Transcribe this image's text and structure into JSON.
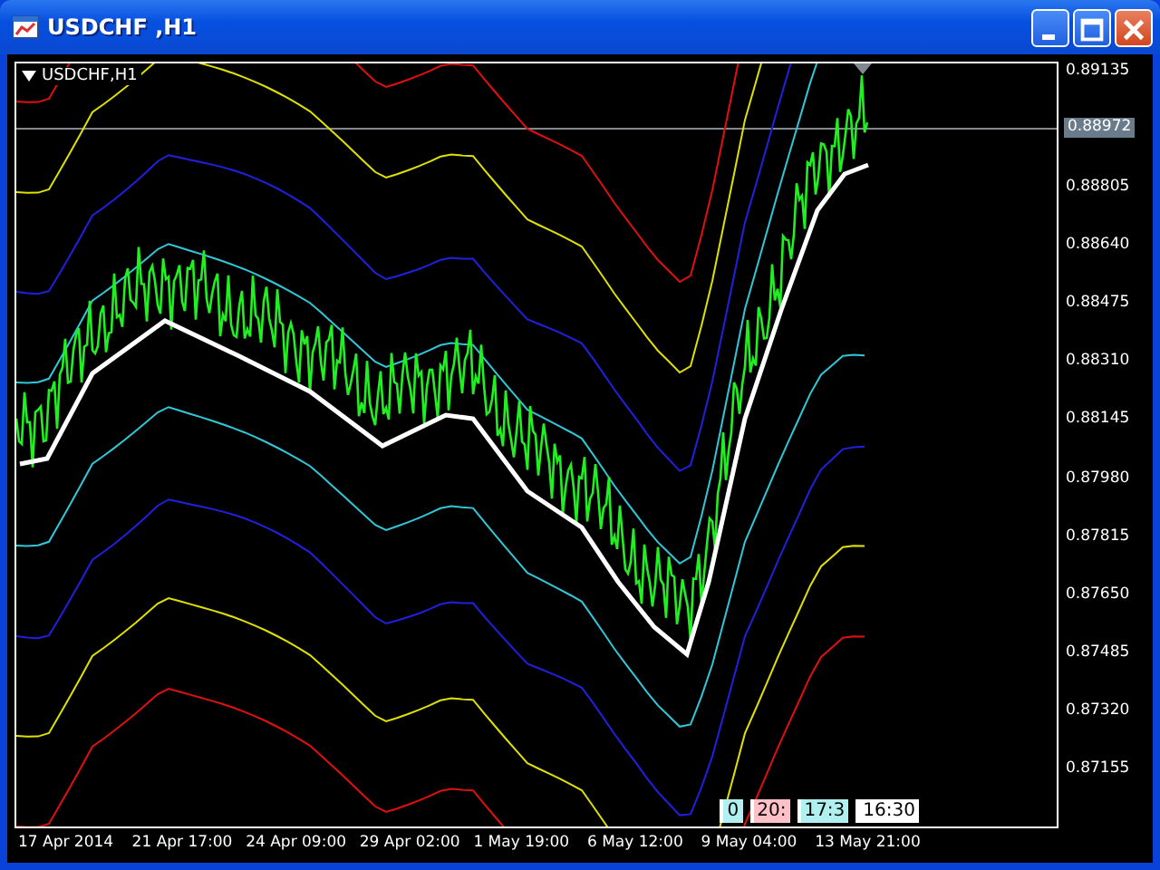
{
  "window": {
    "title": "USDCHF ,H1"
  },
  "chart": {
    "symbol_label": "USDCHF,H1",
    "price_tag": "0.88972",
    "y_axis": [
      "0.89135",
      "0.88805",
      "0.88640",
      "0.88475",
      "0.88310",
      "0.88145",
      "0.87980",
      "0.87815",
      "0.87650",
      "0.87485",
      "0.87320",
      "0.87155"
    ],
    "x_axis": [
      "17 Apr 2014",
      "21 Apr 17:00",
      "24 Apr 09:00",
      "29 Apr 02:00",
      "1 May 19:00",
      "6 May 12:00",
      "9 May 04:00",
      "13 May 21:00"
    ],
    "time_markers": [
      {
        "text": "0",
        "color": "#b0f0f0"
      },
      {
        "text": "20:",
        "color": "#ffc0c8"
      },
      {
        "text": "17:3",
        "color": "#b0f0f0"
      },
      {
        "text": "16:30",
        "color": "#ffffff"
      }
    ]
  }
}
